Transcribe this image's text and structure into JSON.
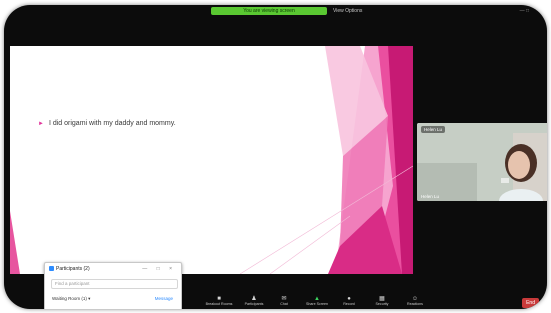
{
  "header": {
    "screen_share_label": "You are viewing screen",
    "view_options": "View Options",
    "top_right": "— □"
  },
  "slide": {
    "bullet_text": "I did origami with my daddy and mommy."
  },
  "video": {
    "participant_name": "Helen Lu",
    "caption": "Helen Lu"
  },
  "participants_panel": {
    "title": "Participants (2)",
    "window_controls": "— □ ×",
    "search_placeholder": "Find a participant",
    "waiting_room": "Waiting Room (1) ▾",
    "admit_label": "Message"
  },
  "toolbar": {
    "items": [
      {
        "label": "Mute",
        "icon": "microphone-icon"
      },
      {
        "label": "Start Video",
        "icon": "camera-icon"
      },
      {
        "label": "Security",
        "icon": "shield-icon"
      },
      {
        "label": "Participants",
        "icon": "people-icon"
      },
      {
        "label": "Chat",
        "icon": "chat-icon"
      },
      {
        "label": "Share Screen",
        "icon": "share-icon"
      },
      {
        "label": "Record",
        "icon": "record-icon"
      },
      {
        "label": "Breakout Rooms",
        "icon": "grid-icon"
      },
      {
        "label": "Reactions",
        "icon": "smiley-icon"
      }
    ],
    "end_label": "End"
  },
  "colors": {
    "share_green": "#5ac832",
    "slide_pink": "#e0349a",
    "zoom_blue": "#2d8cff"
  }
}
